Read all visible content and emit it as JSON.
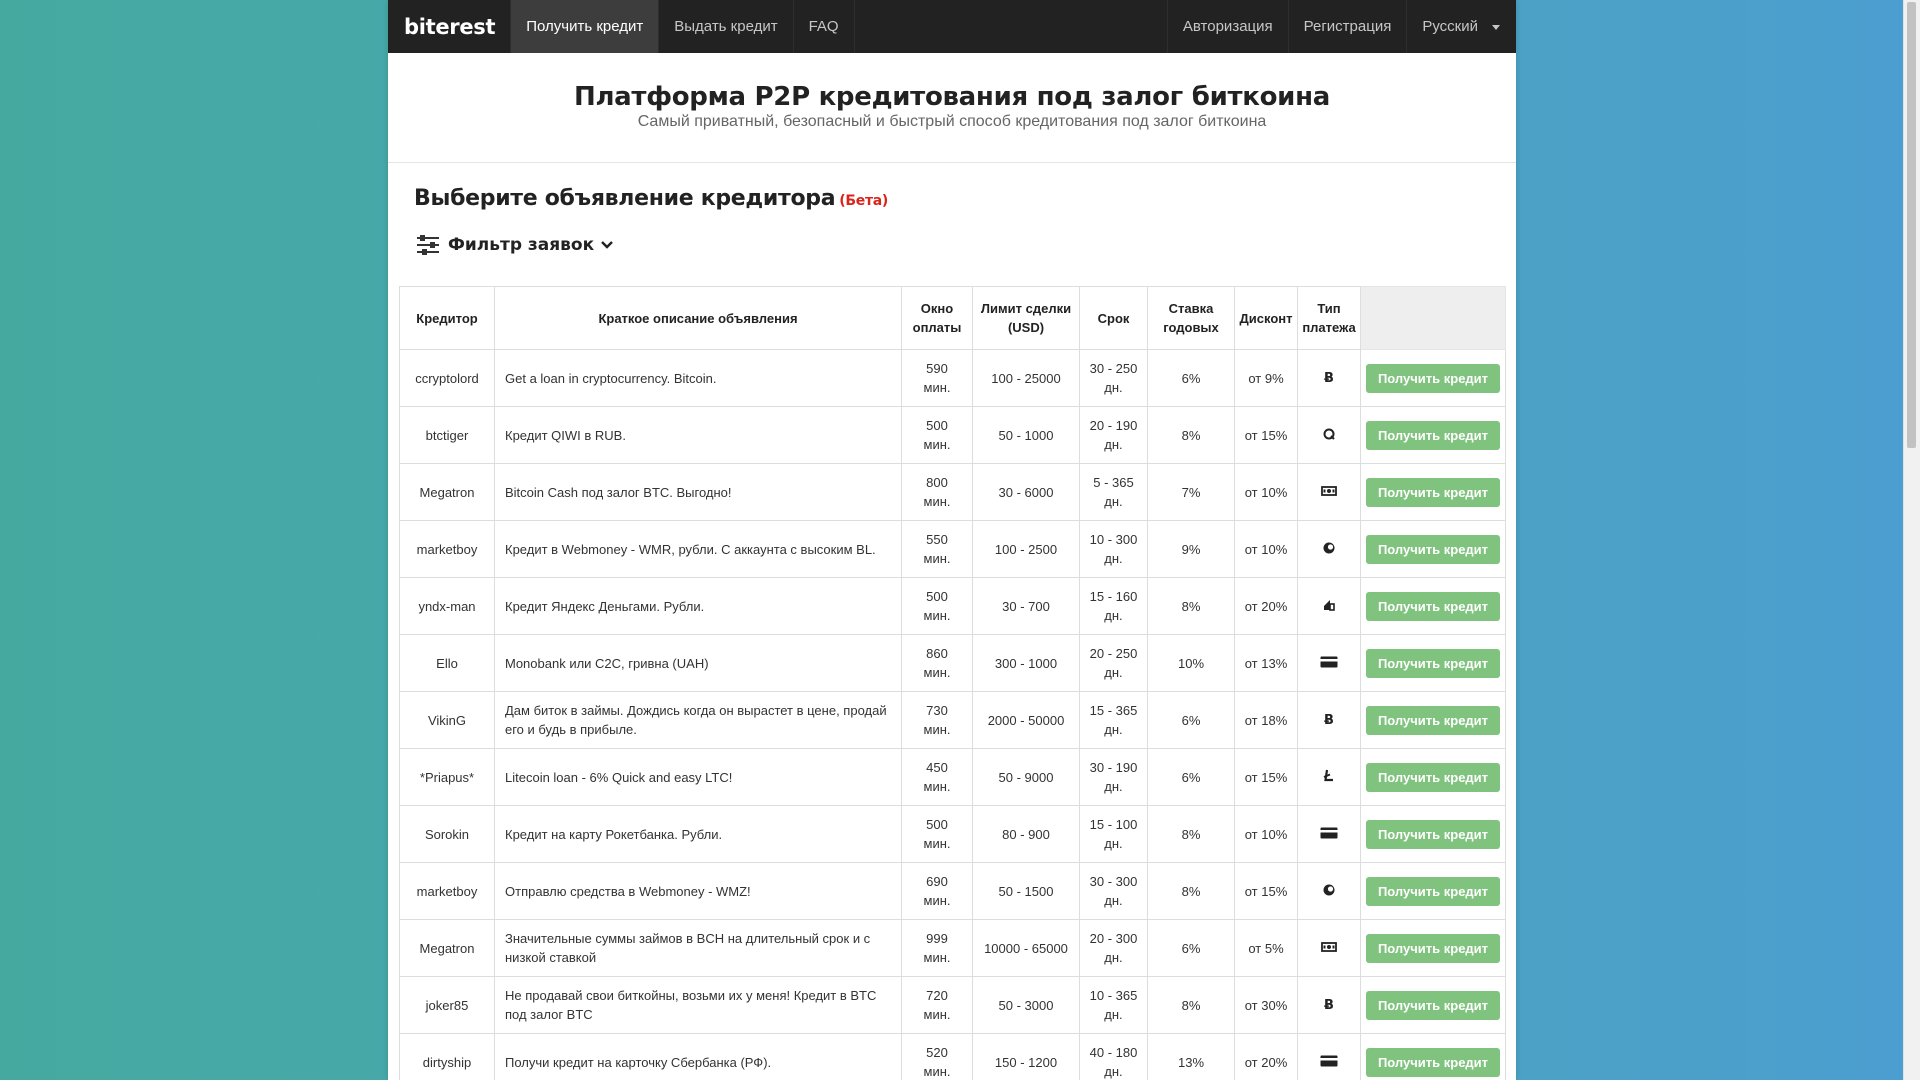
{
  "nav": {
    "brand": "biterest",
    "items": [
      {
        "label": "Получить кредит",
        "active": true
      },
      {
        "label": "Выдать кредит",
        "active": false
      },
      {
        "label": "FAQ",
        "active": false
      }
    ],
    "right_items": [
      {
        "label": "Авторизация"
      },
      {
        "label": "Регистрация"
      }
    ],
    "language": "Русский"
  },
  "hero": {
    "title": "Платформа P2P кредитования под залог биткоина",
    "subtitle": "Самый приватный, безопасный и быстрый способ кредитования под залог биткоина"
  },
  "section": {
    "title": "Выберите объявление кредитора",
    "beta": "(Бета)"
  },
  "filter": {
    "label": "Фильтр заявок"
  },
  "table": {
    "headers": {
      "lender": "Кредитор",
      "description": "Краткое описание объявления",
      "window_1": "Окно",
      "window_2": "оплаты",
      "limit_1": "Лимит сделки",
      "limit_2": "(USD)",
      "term": "Срок",
      "rate_1": "Ставка",
      "rate_2": "годовых",
      "discount": "Дисконт",
      "pay_1": "Тип",
      "pay_2": "платежа"
    },
    "button_label": "Получить кредит",
    "rows": [
      {
        "lender": "ccryptolord",
        "desc": "Get a loan in cryptocurrency. Bitcoin.",
        "window": "590",
        "window_unit": "мин.",
        "limit": "100 - 25000",
        "term": "30 - 250",
        "term_unit": "дн.",
        "rate": "6%",
        "discount": "от 9%",
        "pay": "bitcoin-icon"
      },
      {
        "lender": "btctiger",
        "desc": "Кредит QIWI в RUB.",
        "window": "500",
        "window_unit": "мин.",
        "limit": "50 - 1000",
        "term": "20 - 190",
        "term_unit": "дн.",
        "rate": "8%",
        "discount": "от 15%",
        "pay": "qiwi-icon"
      },
      {
        "lender": "Megatron",
        "desc": "Bitcoin Cash под залог BTC. Выгодно!",
        "window": "800",
        "window_unit": "мин.",
        "limit": "30 - 6000",
        "term": "5 - 365",
        "term_unit": "дн.",
        "rate": "7%",
        "discount": "от 10%",
        "pay": "cash-icon"
      },
      {
        "lender": "marketboy",
        "desc": "Кредит в Webmoney - WMR, рубли. С аккаунта с высоким BL.",
        "window": "550",
        "window_unit": "мин.",
        "limit": "100 - 2500",
        "term": "10 - 300",
        "term_unit": "дн.",
        "rate": "9%",
        "discount": "от 10%",
        "pay": "webmoney-icon"
      },
      {
        "lender": "yndx-man",
        "desc": "Кредит Яндекс Деньгами. Рубли.",
        "window": "500",
        "window_unit": "мин.",
        "limit": "30 - 700",
        "term": "15 - 160",
        "term_unit": "дн.",
        "rate": "8%",
        "discount": "от 20%",
        "pay": "yandex-money-icon"
      },
      {
        "lender": "Ello",
        "desc": "Monobank или C2C, гривна (UAH)",
        "window": "860",
        "window_unit": "мин.",
        "limit": "300 - 1000",
        "term": "20 - 250",
        "term_unit": "дн.",
        "rate": "10%",
        "discount": "от 13%",
        "pay": "credit-card-icon"
      },
      {
        "lender": "VikinG",
        "desc": "Дам биток в займы. Дождись когда он вырастет в цене, продай его и будь в прибыле.",
        "window": "730",
        "window_unit": "мин.",
        "limit": "2000 - 50000",
        "term": "15 - 365",
        "term_unit": "дн.",
        "rate": "6%",
        "discount": "от 18%",
        "pay": "bitcoin-icon"
      },
      {
        "lender": "*Priapus*",
        "desc": "Litecoin loan - 6% Quick and easy LTC!",
        "window": "450",
        "window_unit": "мин.",
        "limit": "50 - 9000",
        "term": "30 - 190",
        "term_unit": "дн.",
        "rate": "6%",
        "discount": "от 15%",
        "pay": "litecoin-icon"
      },
      {
        "lender": "Sorokin",
        "desc": "Кредит на карту Рокетбанка. Рубли.",
        "window": "500",
        "window_unit": "мин.",
        "limit": "80 - 900",
        "term": "15 - 100",
        "term_unit": "дн.",
        "rate": "8%",
        "discount": "от 10%",
        "pay": "credit-card-icon"
      },
      {
        "lender": "marketboy",
        "desc": "Отправлю средства в Webmoney - WMZ!",
        "window": "690",
        "window_unit": "мин.",
        "limit": "50 - 1500",
        "term": "30 - 300",
        "term_unit": "дн.",
        "rate": "8%",
        "discount": "от 15%",
        "pay": "webmoney-icon"
      },
      {
        "lender": "Megatron",
        "desc": "Значительные суммы займов в BCH на длительный срок и с низкой ставкой",
        "window": "999",
        "window_unit": "мин.",
        "limit": "10000 - 65000",
        "term": "20 - 300",
        "term_unit": "дн.",
        "rate": "6%",
        "discount": "от 5%",
        "pay": "cash-icon"
      },
      {
        "lender": "joker85",
        "desc": "Не продавай свои биткойны, возьми их у меня! Кредит в BTC под залог BTC",
        "window": "720",
        "window_unit": "мин.",
        "limit": "50 - 3000",
        "term": "10 - 365",
        "term_unit": "дн.",
        "rate": "8%",
        "discount": "от 30%",
        "pay": "bitcoin-icon"
      },
      {
        "lender": "dirtyship",
        "desc": "Получи кредит на карточку Сбербанка (РФ).",
        "window": "520",
        "window_unit": "мин.",
        "limit": "150 - 1200",
        "term": "40 - 180",
        "term_unit": "дн.",
        "rate": "13%",
        "discount": "от 20%",
        "pay": "credit-card-icon"
      }
    ]
  }
}
